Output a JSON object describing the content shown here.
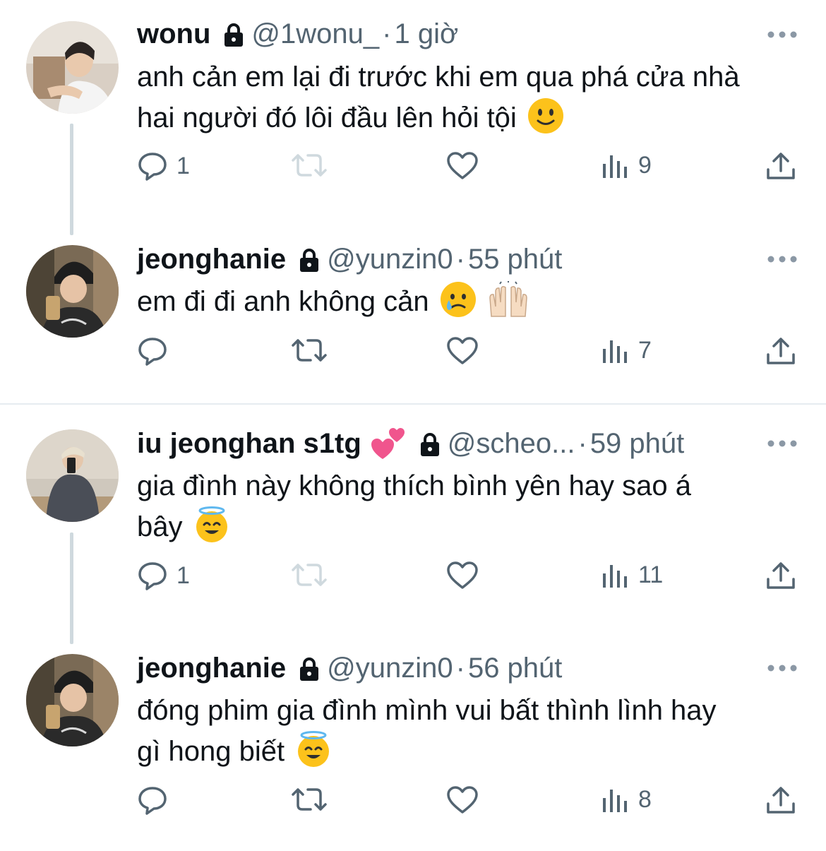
{
  "tweets": [
    {
      "name": "wonu",
      "handle": "@1wonu_",
      "sep": "·",
      "time": "1 giờ",
      "lines": [
        "anh cản em lại đi trước khi em qua phá cửa nhà",
        "hai người đó lôi đầu lên hỏi tội"
      ],
      "emoji": "slightly-smiling-face",
      "reply_count": "1",
      "views_count": "9",
      "retweet_active": false
    },
    {
      "name": "jeonghanie",
      "handle": "@yunzin0",
      "sep": "·",
      "time": "55 phút",
      "lines": [
        "em đi đi anh không cản"
      ],
      "emoji": "face-holding-back-tears, raising-hands",
      "reply_count": "",
      "views_count": "7",
      "retweet_active": true
    },
    {
      "name": "iu jeonghan s1tg",
      "handle": "@scheo...",
      "sep": "·",
      "time": "59 phút",
      "lines": [
        "gia đình này không thích bình yên hay sao á",
        "bây"
      ],
      "emoji": "smiling-face-with-halo",
      "reply_count": "1",
      "views_count": "11",
      "retweet_active": false
    },
    {
      "name": "jeonghanie",
      "handle": "@yunzin0",
      "sep": "·",
      "time": "56 phút",
      "lines": [
        "đóng phim gia đình mình vui bất thình lình hay",
        "gì hong biết"
      ],
      "emoji": "smiling-face-with-halo",
      "reply_count": "",
      "views_count": "8",
      "retweet_active": true
    }
  ],
  "colors": {
    "text": "#0f1419",
    "muted": "#536471",
    "muted_light": "#cfd9de",
    "divider": "#e6ecf0",
    "emoji_yellow": "#fcc21b"
  },
  "icons": [
    "lock-icon",
    "more-icon",
    "reply-icon",
    "retweet-icon",
    "like-icon",
    "views-icon",
    "share-icon"
  ]
}
